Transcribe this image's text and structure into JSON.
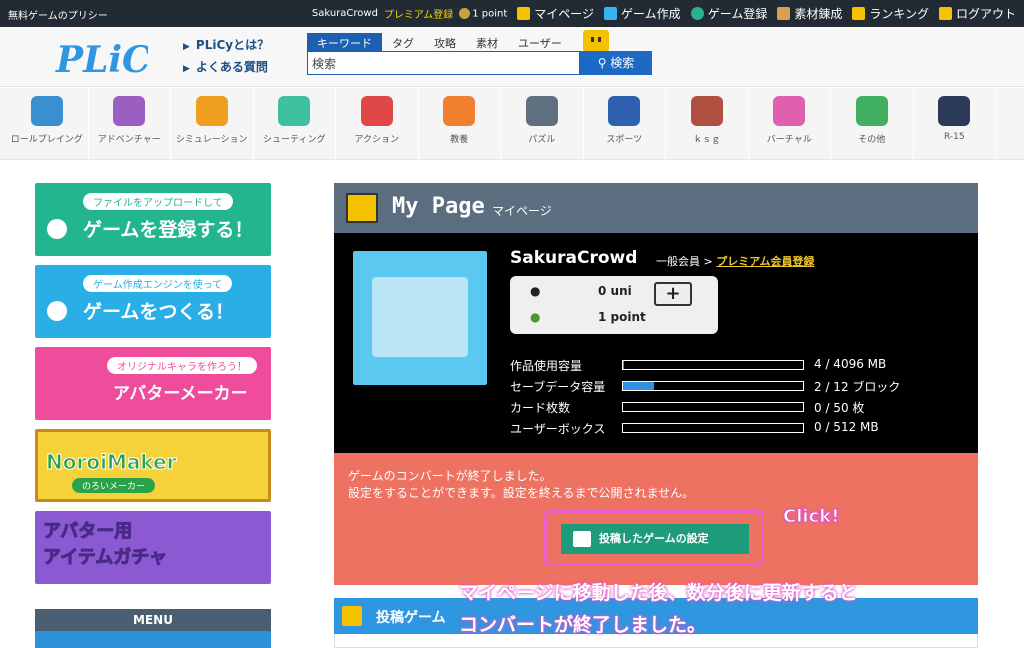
{
  "topbar": {
    "policy": "無料ゲームのプリシー",
    "username": "SakuraCrowd",
    "premium_link": "プレミアム登録",
    "points": "1 point",
    "nav": [
      {
        "label": "マイページ",
        "color": "#f5c300"
      },
      {
        "label": "ゲーム作成",
        "color": "#36b3f0"
      },
      {
        "label": "ゲーム登録",
        "color": "#29b38c"
      },
      {
        "label": "素材錬成",
        "color": "#f0f0f0"
      },
      {
        "label": "ランキング",
        "color": "#f5c300"
      },
      {
        "label": "ログアウト",
        "color": "#f5c300"
      }
    ]
  },
  "header": {
    "logo_text": "PLiCy",
    "links": [
      "PLiCyとは？",
      "よくある質問"
    ],
    "search_tabs": [
      "キーワード",
      "タグ",
      "攻略",
      "素材",
      "ユーザー"
    ],
    "search_placeholder": "検索",
    "search_button": "検索"
  },
  "categories": [
    {
      "label": "ロールプレイング",
      "color": "#3a8fd0"
    },
    {
      "label": "アドベンチャー",
      "color": "#9a5fc0"
    },
    {
      "label": "シミュレーション",
      "color": "#f0a020"
    },
    {
      "label": "シューティング",
      "color": "#3fc0a0"
    },
    {
      "label": "アクション",
      "color": "#e04848"
    },
    {
      "label": "教養",
      "color": "#f08030"
    },
    {
      "label": "パズル",
      "color": "#607080"
    },
    {
      "label": "スポーツ",
      "color": "#3060b0"
    },
    {
      "label": "ｋｓｇ",
      "color": "#b05040"
    },
    {
      "label": "バーチャル",
      "color": "#e060b0"
    },
    {
      "label": "その他",
      "color": "#40b060"
    },
    {
      "label": "R-15",
      "color": "#2a3a58"
    }
  ],
  "sidebar": {
    "banners": [
      {
        "pill": "ファイルをアップロードして",
        "big": "ゲームを登録する！",
        "color": "#22b58e"
      },
      {
        "pill": "ゲーム作成エンジンを使って",
        "big": "ゲームをつくる！",
        "color": "#29aee6"
      },
      {
        "pill": "オリジナルキャラを作ろう！",
        "big": "アバターメーカー",
        "color": "#ef4d9c"
      },
      {
        "pill": "のろいメーカー",
        "big": "NoroiMaker",
        "color": "#c88a1a"
      },
      {
        "pill": "",
        "big": "アバター用\nアイテムガチャ",
        "color": "#8b5ad2"
      }
    ],
    "menu_title": "MENU"
  },
  "mypage": {
    "title": "My Page",
    "subtitle": "マイページ",
    "username": "SakuraCrowd",
    "role": "一般会員 >",
    "premium_link": "プレミアム会員登録",
    "uni": "0 uni",
    "point": "1 point",
    "plus": "+",
    "stats": [
      {
        "label": "作品使用容量",
        "fraction": 0.001,
        "value": "4 / 4096 MB"
      },
      {
        "label": "セーブデータ容量",
        "fraction": 0.17,
        "value": "2 / 12 ブロック"
      },
      {
        "label": "カード枚数",
        "fraction": 0,
        "value": "0 / 50 枚"
      },
      {
        "label": "ユーザーボックス",
        "fraction": 0,
        "value": "0 / 512 MB"
      }
    ],
    "notice_line1": "ゲームのコンバートが終了しました。",
    "notice_line2": "設定をすることができます。設定を終えるまで公開されません。",
    "settings_button": "投稿したゲームの設定"
  },
  "annotations": {
    "click": "Click!",
    "line1": "マイページに移動した後、数分後に更新すると",
    "line2": "コンバートが終了しました。"
  },
  "posted": {
    "title": "投稿ゲーム"
  }
}
